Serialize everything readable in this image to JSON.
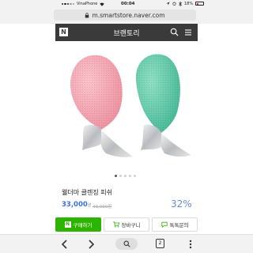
{
  "status_bar": {
    "carrier": "VinaPhone",
    "time": "00:04",
    "battery_percent": "18%"
  },
  "browser": {
    "url": "m.smartstore.naver.com",
    "tab_count": "2"
  },
  "header": {
    "logo_letter": "N",
    "title": "브랜토리"
  },
  "product": {
    "name": "웰더마 클렌징 피쉬",
    "price": "33,000",
    "price_unit": "원",
    "original_price": "49,000원",
    "discount": "32%",
    "image_colors": [
      "#f4a6b3",
      "#5fc9a8"
    ],
    "carousel": {
      "total": 5,
      "active_index": 0
    }
  },
  "actions": {
    "buy_label": "구매하기",
    "cart_label": "장바구니",
    "talk_label": "톡톡문의",
    "buy_icon_letter": "N"
  },
  "colors": {
    "accent_green": "#2db400",
    "price_blue": "#3b72e0",
    "header_dark": "#3a3a3a"
  }
}
